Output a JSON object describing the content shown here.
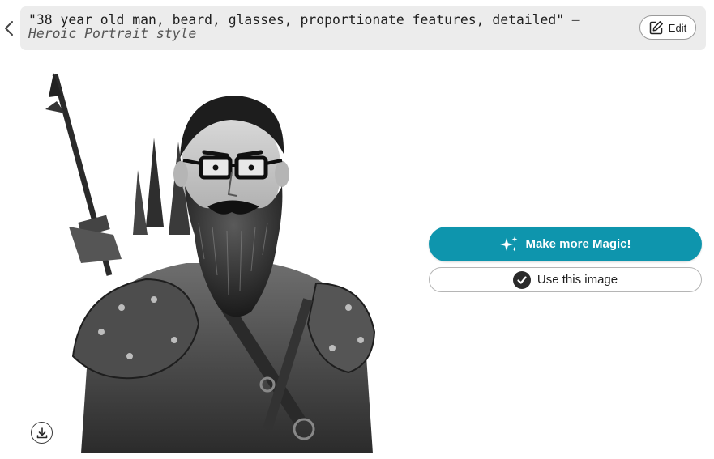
{
  "prompt": {
    "text": "\"38 year old man, beard, glasses, proportionate features, detailed\"",
    "separator": " — ",
    "style": "Heroic Portrait style"
  },
  "edit_button": {
    "label": "Edit",
    "icon": "edit-pencil-icon"
  },
  "back_button": {
    "icon": "chevron-left-icon"
  },
  "image": {
    "alt": "Black and white illustration of a bearded man with glasses in leather armor holding a spear",
    "download_icon": "download-icon"
  },
  "actions": {
    "magic": {
      "label": "Make more Magic!",
      "icon": "sparkles-icon",
      "color": "#0e95ad"
    },
    "use": {
      "label": "Use this image",
      "icon": "check-circle-icon"
    }
  }
}
